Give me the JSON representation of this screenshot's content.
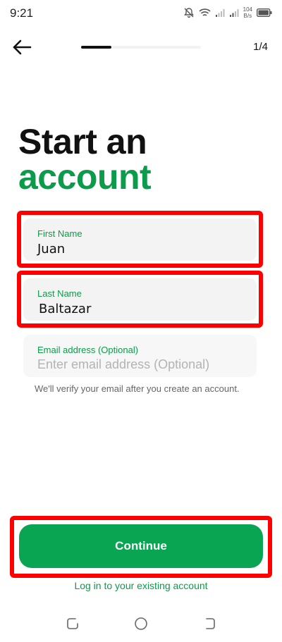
{
  "status_bar": {
    "time": "9:21",
    "net_speed_value": "104",
    "net_speed_unit": "B/s",
    "icons": [
      "mute-icon",
      "wifi-icon",
      "signal-icon",
      "signal-icon",
      "battery-icon"
    ]
  },
  "header": {
    "back_icon": "arrow-left-icon",
    "step": "1/4",
    "progress_fraction": 0.25
  },
  "title": {
    "line1": "Start an",
    "line2": "account"
  },
  "form": {
    "first_name": {
      "label": "First Name",
      "value": "Juan"
    },
    "last_name": {
      "label": "Last Name",
      "value": "Baltazar"
    },
    "email": {
      "label": "Email address (Optional)",
      "placeholder": "Enter email address (Optional)",
      "value": ""
    },
    "helper": "We'll verify your email after you create an account."
  },
  "actions": {
    "continue_label": "Continue",
    "login_label": "Log in to your existing account"
  },
  "colors": {
    "accent_green": "#0b9b4a",
    "button_green": "#0aa552",
    "highlight_red": "#ff0000"
  }
}
